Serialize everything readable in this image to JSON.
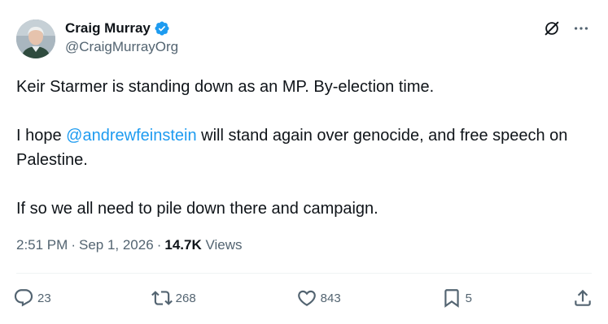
{
  "author": {
    "display_name": "Craig Murray",
    "handle": "@CraigMurrayOrg",
    "verified": true
  },
  "tweet": {
    "line1": "Keir Starmer is standing down as an MP. By-election time.",
    "line2_prefix": "I hope ",
    "mention": "@andrewfeinstein",
    "line2_suffix": " will stand again over genocide, and free speech on Palestine.",
    "line3": "If so we all need to pile down there and campaign."
  },
  "meta": {
    "time": "2:51 PM",
    "date": "Sep 1, 2026",
    "views_count": "14.7K",
    "views_label": "Views"
  },
  "actions": {
    "replies": "23",
    "retweets": "268",
    "likes": "843",
    "bookmarks": "5"
  },
  "icons": {
    "verified": "verified-badge-icon",
    "grok": "grok-icon",
    "more": "more-icon",
    "reply": "reply-icon",
    "retweet": "retweet-icon",
    "like": "heart-icon",
    "bookmark": "bookmark-icon",
    "share": "share-icon"
  },
  "colors": {
    "accent": "#1d9bf0",
    "text": "#0f1419",
    "secondary": "#536471"
  }
}
